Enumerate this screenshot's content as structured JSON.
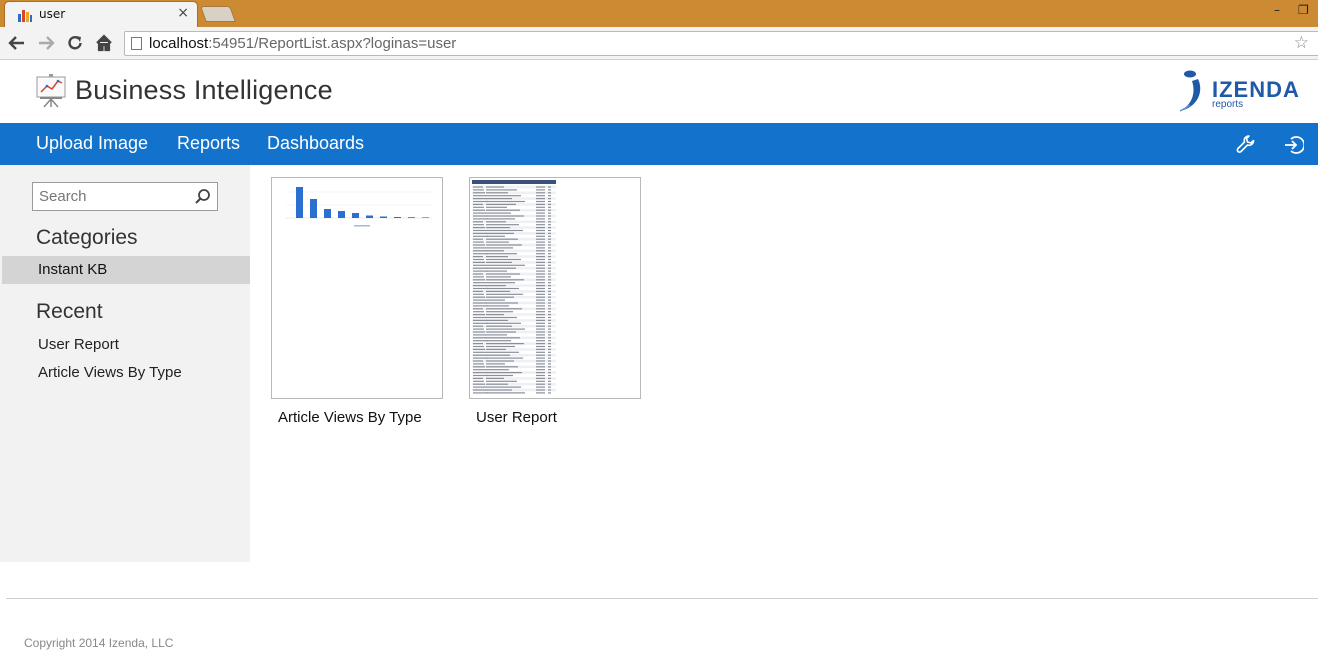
{
  "browser": {
    "tab_title": "user",
    "tab_close": "×",
    "url_host": "localhost",
    "url_rest": ":54951/ReportList.aspx?loginas=user",
    "minimize": "–",
    "restore": "❐"
  },
  "header": {
    "title": "Business Intelligence",
    "brand": "IZENDA",
    "brand_sub": "reports"
  },
  "nav": {
    "items": [
      {
        "label": "Upload Image"
      },
      {
        "label": "Reports"
      },
      {
        "label": "Dashboards"
      }
    ]
  },
  "sidebar": {
    "search_placeholder": "Search",
    "categories_title": "Categories",
    "categories": [
      {
        "label": "Instant KB"
      }
    ],
    "recent_title": "Recent",
    "recent": [
      {
        "label": "User Report"
      },
      {
        "label": "Article Views By Type"
      }
    ]
  },
  "reports": [
    {
      "label": "Article Views By Type"
    },
    {
      "label": "User Report"
    }
  ],
  "footer": {
    "copyright": "Copyright 2014 Izenda, LLC"
  },
  "colors": {
    "navbar": "#1373cc",
    "tabbar": "#cc8a32",
    "brand": "#1f5aa6"
  }
}
